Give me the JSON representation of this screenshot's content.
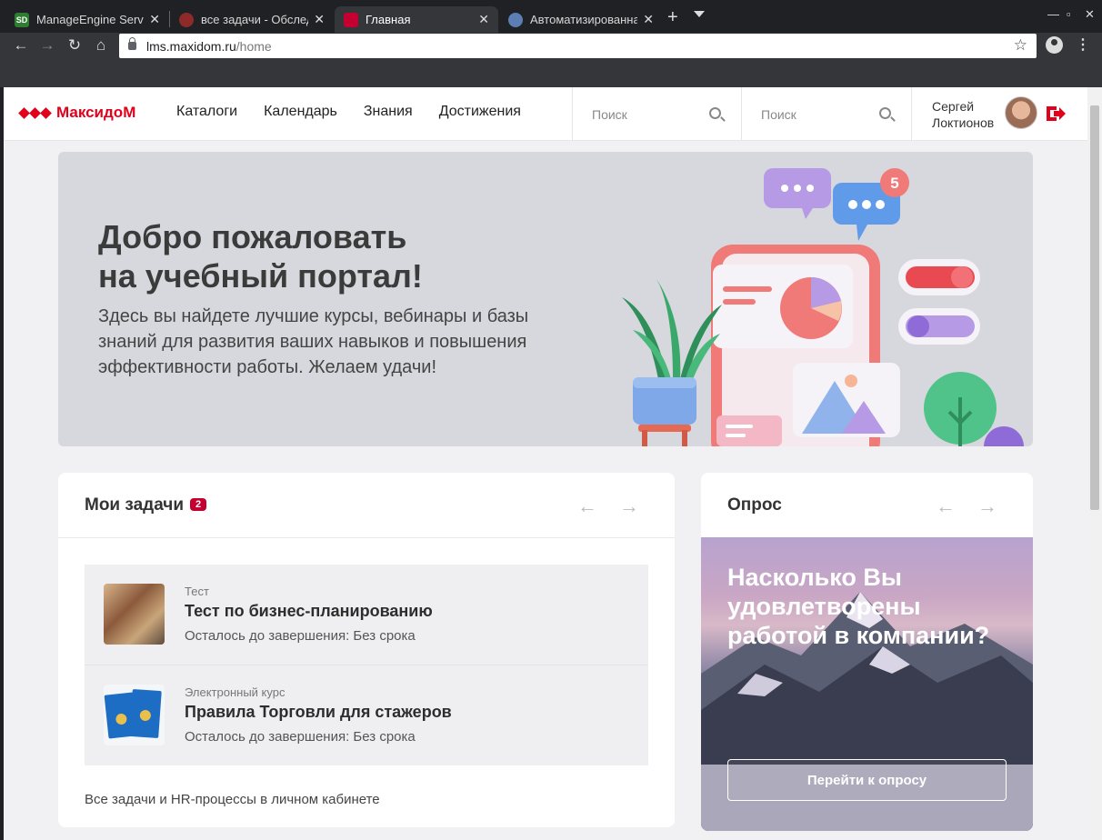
{
  "browser": {
    "tabs": [
      {
        "title": "ManageEngine ServiceDesk",
        "favicon": "sd-favicon",
        "color": "#2e7d32"
      },
      {
        "title": "все задачи - Обследование",
        "favicon": "jira-favicon",
        "color": "#8e2a2a"
      },
      {
        "title": "Главная",
        "favicon": "maxidom-favicon",
        "color": "#c3002f"
      },
      {
        "title": "Автоматизированная система",
        "favicon": "globe-favicon",
        "color": "#5b7fb5"
      }
    ],
    "new_tab": "+",
    "url_domain": "lms.maxidom.ru",
    "url_path": "/home"
  },
  "site": {
    "logo_text": "МаксидоМ",
    "nav": [
      "Каталоги",
      "Календарь",
      "Знания",
      "Достижения"
    ],
    "search1_placeholder": "Поиск",
    "search2_placeholder": "Поиск",
    "user_first": "Сергей",
    "user_last": "Локтионов",
    "accent": "#e2001a"
  },
  "banner": {
    "title_line1": "Добро пожаловать",
    "title_line2": "на учебный портал!",
    "text": "Здесь вы найдете лучшие курсы, вебинары и базы знаний для развития ваших навыков и повышения эффективности работы. Желаем удачи!",
    "notification_count": "5"
  },
  "tasks": {
    "header": "Мои задачи",
    "count": "2",
    "items": [
      {
        "type": "Тест",
        "title": "Тест по бизнес-планированию",
        "due": "Осталось до завершения: Без срока"
      },
      {
        "type": "Электронный курс",
        "title": "Правила Торговли для стажеров",
        "due": "Осталось до завершения: Без срока"
      }
    ],
    "footer": "Все задачи и HR-процессы в личном кабинете"
  },
  "survey": {
    "header": "Опрос",
    "question": "Насколько Вы удовлетворены работой в компании?",
    "button": "Перейти к опросу"
  }
}
